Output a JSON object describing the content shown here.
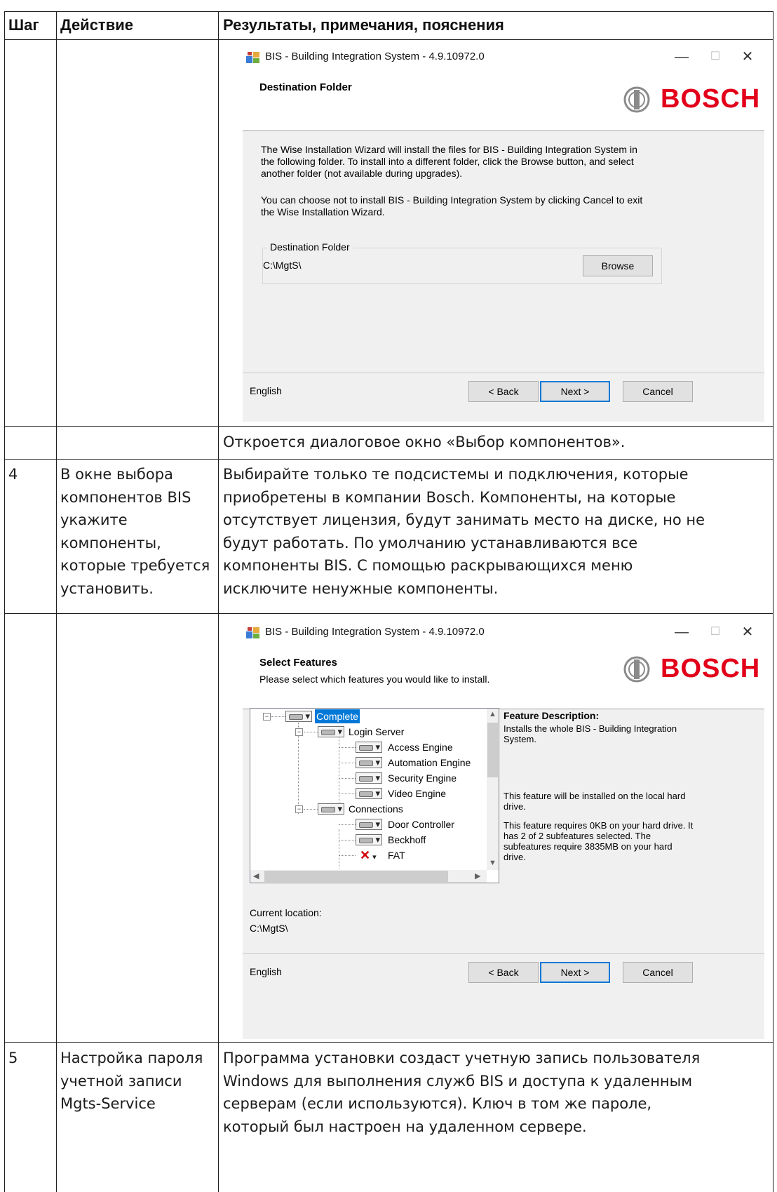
{
  "table": {
    "headers": [
      "Шаг",
      "Действие",
      "Результаты, примечания, пояснения"
    ],
    "rows": [
      {
        "step": "",
        "action": "",
        "result": "Откроется диалоговое окно «Выбор компонентов»."
      },
      {
        "step": "4",
        "action": [
          "В окне выбора",
          "компонентов BIS",
          "укажите",
          "компоненты,",
          "которые требуется",
          "установить."
        ],
        "result": [
          "Выбирайте только те подсистемы и подключения, которые",
          "приобретены в компании Bosch. Компоненты, на которые",
          "отсутствует лицензия, будут занимать место на диске, но не",
          "будут работать. По умолчанию устанавливаются все",
          "компоненты BIS. С помощью раскрывающихся меню",
          "исключите ненужные компоненты."
        ]
      },
      {
        "step": "5",
        "action": [
          "Настройка пароля",
          "учетной записи",
          "Mgts-Service"
        ],
        "result": [
          "Программа установки создаст учетную запись пользователя",
          "Windows для выполнения служб BIS и доступа к удаленным",
          "серверам (если используются). Ключ в том же пароле,",
          "который был настроен на удаленном сервере."
        ]
      }
    ]
  },
  "dialog1": {
    "window_title": "BIS - Building Integration System - 4.9.10972.0",
    "banner_title": "Destination Folder",
    "logo_text": "BOSCH",
    "paragraph1": [
      "The Wise Installation Wizard will install the files for BIS - Building Integration System in",
      "the following folder. To install into a different folder, click the Browse button, and select",
      "another folder (not available during upgrades)."
    ],
    "paragraph2": [
      "You can choose not to install BIS - Building Integration System by clicking Cancel to exit",
      "the Wise Installation Wizard."
    ],
    "group_label": "Destination Folder",
    "path": "C:\\MgtS\\",
    "browse_label": "Browse",
    "language": "English",
    "back_label": "< Back",
    "next_label": "Next >",
    "cancel_label": "Cancel"
  },
  "dialog2": {
    "window_title": "BIS - Building Integration System - 4.9.10972.0",
    "banner_title": "Select Features",
    "banner_subtitle": "Please select which features you would like to install.",
    "logo_text": "BOSCH",
    "tree": [
      {
        "label": "Complete",
        "level": 0,
        "state": "install",
        "selected": true
      },
      {
        "label": "Login Server",
        "level": 1,
        "state": "install"
      },
      {
        "label": "Access Engine",
        "level": 2,
        "state": "install"
      },
      {
        "label": "Automation Engine",
        "level": 2,
        "state": "install"
      },
      {
        "label": "Security Engine",
        "level": 2,
        "state": "install"
      },
      {
        "label": "Video Engine",
        "level": 2,
        "state": "install"
      },
      {
        "label": "Connections",
        "level": 1,
        "state": "install"
      },
      {
        "label": "Door Controller",
        "level": 2,
        "state": "install"
      },
      {
        "label": "Beckhoff",
        "level": 2,
        "state": "install"
      },
      {
        "label": "FAT",
        "level": 2,
        "state": "excluded"
      }
    ],
    "feature_description_title": "Feature Description:",
    "feature_description": [
      "Installs the whole BIS - Building Integration",
      "System."
    ],
    "install_note": [
      "This feature will be installed on the local hard",
      "drive."
    ],
    "size_note": [
      "This feature requires 0KB on your hard drive. It",
      "has 2 of 2 subfeatures selected. The",
      "subfeatures require 3835MB on your hard",
      "drive."
    ],
    "current_location_label": "Current location:",
    "current_location": "C:\\MgtS\\",
    "language": "English",
    "back_label": "< Back",
    "next_label": "Next >",
    "cancel_label": "Cancel"
  },
  "colors": {
    "bosch_red": "#e2001a",
    "selection_blue": "#0078d7",
    "dialog_gray": "#f0f0f0"
  }
}
